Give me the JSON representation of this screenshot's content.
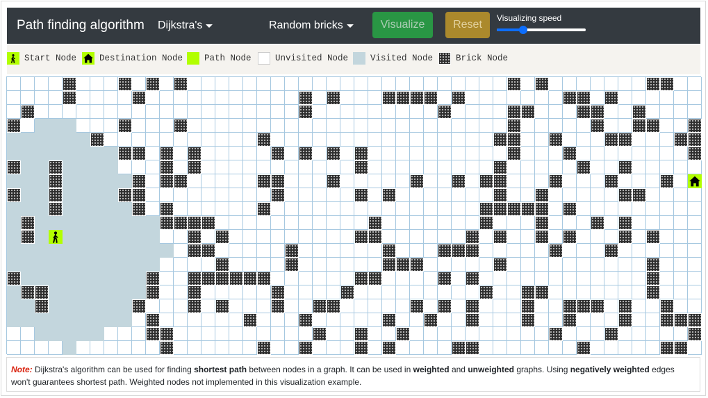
{
  "header": {
    "brand": "Path finding algorithm",
    "algorithm": "Dijkstra's",
    "pattern": "Random bricks",
    "visualize_label": "Visualize",
    "reset_label": "Reset",
    "speed_label": "Visualizing speed",
    "speed_value": 0.3
  },
  "legend": [
    {
      "key": "start",
      "label": "Start Node"
    },
    {
      "key": "destination",
      "label": "Destination Node"
    },
    {
      "key": "path",
      "label": "Path Node"
    },
    {
      "key": "unvisited",
      "label": "Unvisited Node"
    },
    {
      "key": "visited",
      "label": "Visited Node"
    },
    {
      "key": "brick",
      "label": "Brick Node"
    }
  ],
  "colors": {
    "path": "#b2ff00",
    "visited": "#c3d6dd",
    "brick": "#2e2e2e",
    "unvisited": "#ffffff",
    "grid_line": "#a6c8e0"
  },
  "grid": {
    "cols": 50,
    "rows": 20,
    "start": [
      11,
      3
    ],
    "destination": [
      7,
      49
    ],
    "cells": [
      "....#...#.#.#.......................#.#.......##..",
      "....#....#...........#.#...####.#.......##.#......",
      ".#...................#.........#....##...##..#....",
      "#.VVV...#...#.......................#.....#..##..#",
      "VVVVVV#...........#................##..#...##...##",
      "VVVVVVVV##.#.#.....#.#.#.#..........#...#........#",
      "#VV#VVVV...#.#...........#.........#.....#..#.....",
      "VVV#VVVVV#.##.....##...#.....#..#.##...#...#...#.#",
      "#VV#VVVV##.........#.....#.#.......#..#.....##....",
      "VVV#VVVVV#.#......#...............#####.#.........",
      "V#VVVVVVVVV####...........#.......#...#...#.#.....",
      "V#VVVVVVVVV..#.#.........##......#.#..#.#...#.#...",
      "VVVVVVVVVVVV.##.....#......#...###.....#...#......",
      "VVVVVVVVVVV....#....#......###.....#..........#...",
      "#VVVVVVVVV#..######......##....#.#............#...",
      "V##VVVVVVV#..#.....#....#.........#..##.......#...",
      "VV#VVVVVV#...#.#...#..##.....#.#.#...#..###.#..#..",
      "VVVVVVVVV.#......#...#.....#..#..#...#..#...#..###",
      "..VVVVV...##..........#..#..#..........#...#.....#",
      "....V......#......#..#...#.#....##.......#.....##."
    ]
  },
  "note": {
    "prefix": "Note:",
    "t1": " Dijkstra's algorithm can be used for finding ",
    "b1": "shortest path",
    "t2": " between nodes in a graph. It can be used in ",
    "b2": "weighted",
    "t3": " and ",
    "b3": "unweighted",
    "t4": " graphs. Using ",
    "b4": "negatively weighted",
    "t5": " edges won't guarantees shortest path. Weighted nodes not implemented in this visualization example."
  }
}
